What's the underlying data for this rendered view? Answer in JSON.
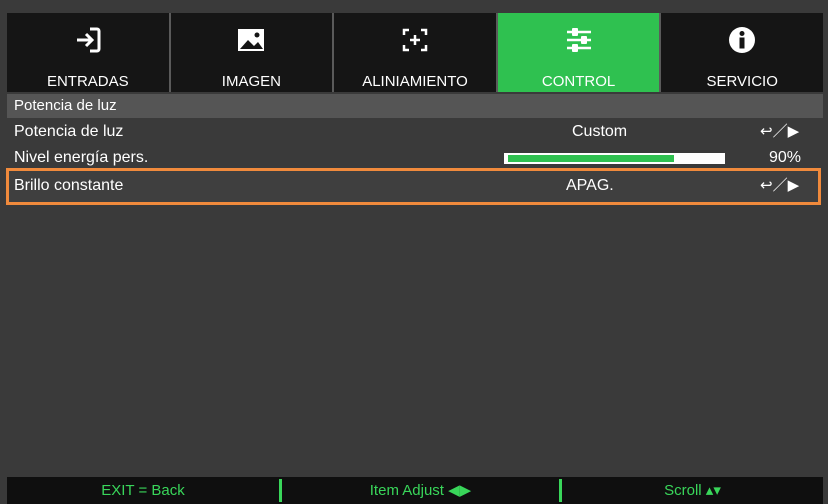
{
  "tabs": [
    {
      "label": "ENTRADAS",
      "icon": "input-icon",
      "active": false
    },
    {
      "label": "IMAGEN",
      "icon": "image-icon",
      "active": false
    },
    {
      "label": "ALINIAMIENTO",
      "icon": "alignment-icon",
      "active": false
    },
    {
      "label": "CONTROL",
      "icon": "sliders-icon",
      "active": true
    },
    {
      "label": "SERVICIO",
      "icon": "info-icon",
      "active": false
    }
  ],
  "section_title": "Potencia de luz",
  "rows": [
    {
      "label": "Potencia de luz",
      "value": "Custom",
      "arrows": "↩／▶"
    },
    {
      "label": "Nivel energía pers.",
      "value": "90%",
      "level": 0.9
    },
    {
      "label": "Brillo constante",
      "value": "APAG.",
      "arrows": "↩／▶"
    }
  ],
  "footer": {
    "exit": "EXIT = Back",
    "adjust": "Item Adjust ◀▶",
    "scroll": "Scroll ▴▾"
  },
  "colors": {
    "accent": "#2fc150",
    "highlight": "#f08a3c"
  }
}
